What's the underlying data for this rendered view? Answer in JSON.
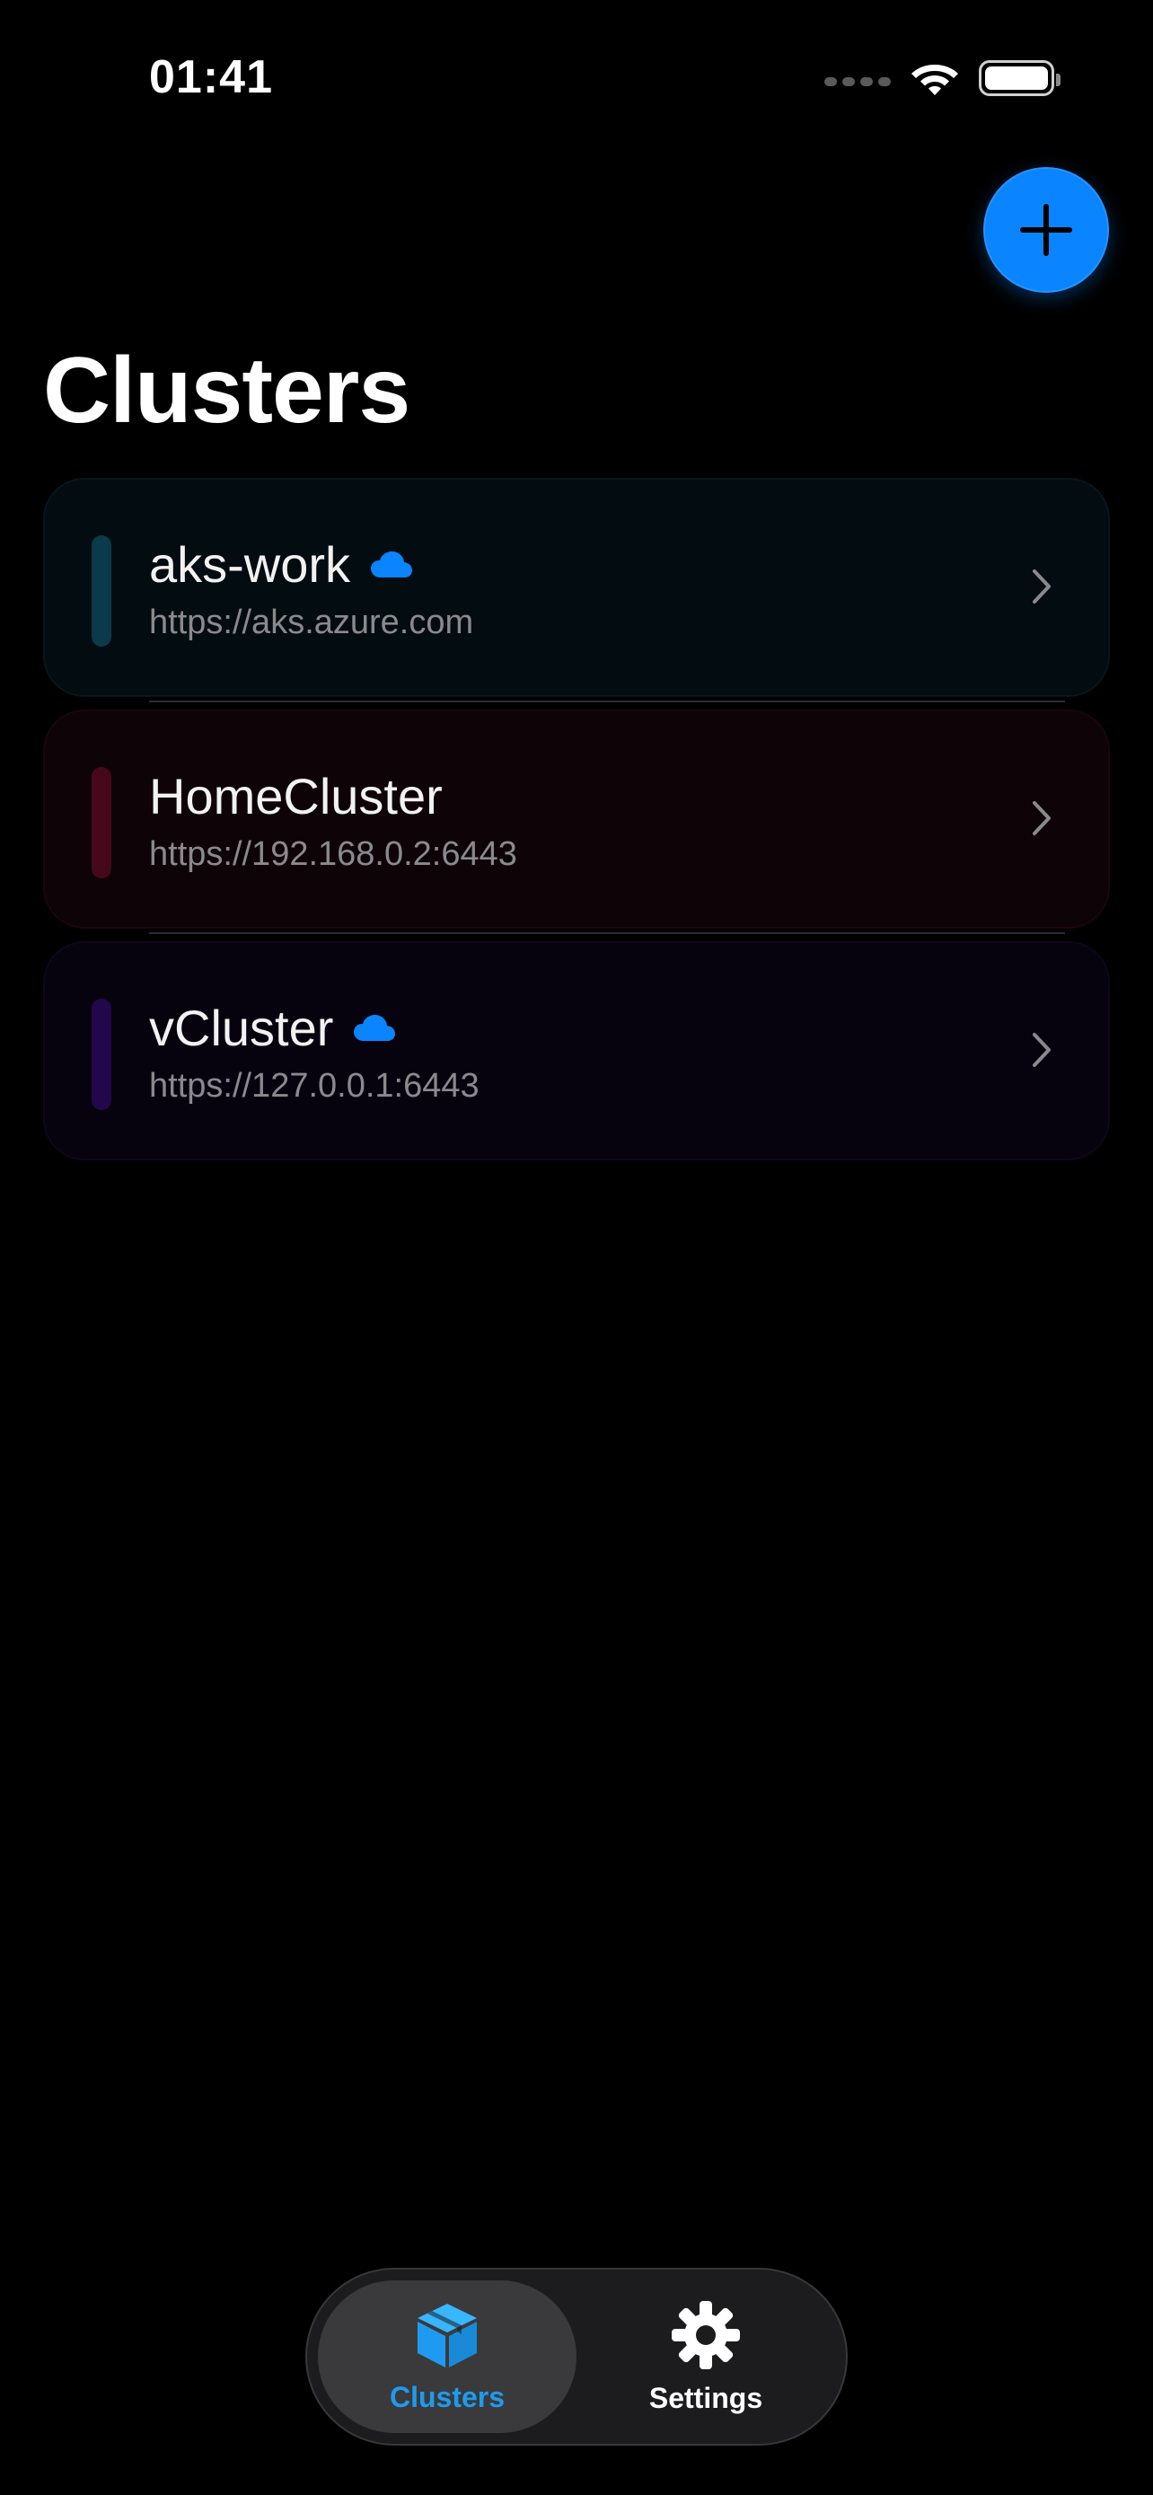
{
  "status_bar": {
    "time": "01:41"
  },
  "header": {
    "add_icon": "plus-icon",
    "title": "Clusters"
  },
  "clusters": [
    {
      "name": "aks-work",
      "url": "https://aks.azure.com",
      "cloud": true,
      "accent": "#0b3a4a"
    },
    {
      "name": "HomeCluster",
      "url": "https://192.168.0.2:6443",
      "cloud": false,
      "accent": "#46091c"
    },
    {
      "name": "vCluster",
      "url": "https://127.0.0.1:6443",
      "cloud": true,
      "accent": "#22084a"
    }
  ],
  "tab_bar": {
    "tabs": [
      {
        "label": "Clusters",
        "icon": "cube-icon",
        "active": true
      },
      {
        "label": "Settings",
        "icon": "gear-icon",
        "active": false
      }
    ]
  },
  "colors": {
    "accent_blue": "#0a84ff",
    "background": "#000000"
  }
}
